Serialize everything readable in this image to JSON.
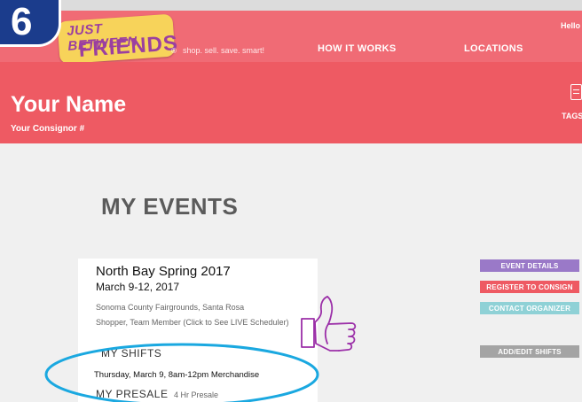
{
  "step_badge": "6",
  "logo": {
    "line1": "JUST BETWEEN",
    "line2": "FRIENDS",
    "reg": "®",
    "tagline": "shop. sell. save. smart!"
  },
  "nav": {
    "how_it_works": "HOW IT WORKS",
    "locations": "LOCATIONS",
    "hello": "Hello"
  },
  "header": {
    "name": "Your Name",
    "consignor": "Your Consignor #",
    "tags_label": "TAGS"
  },
  "page_title": "MY EVENTS",
  "event": {
    "name": "North Bay Spring 2017",
    "dates": "March 9-12, 2017",
    "venue": "Sonoma County Fairgrounds, Santa Rosa",
    "role": "Shopper, Team Member (Click to See LIVE Scheduler)",
    "shifts_heading": "MY SHIFTS",
    "shift": "Thursday, March 9, 8am-12pm Merchandise",
    "presale_heading": "MY PRESALE",
    "presale_detail": "4 Hr Presale"
  },
  "buttons": {
    "event_details": "EVENT DETAILS",
    "register": "REGISTER TO CONSIGN",
    "contact": "CONTACT ORGANIZER",
    "add_edit": "ADD/EDIT SHIFTS"
  },
  "colors": {
    "event_details": "#9a79c8",
    "register": "#ee5a63",
    "contact": "#8fd1d6",
    "add_edit": "#a4a4a4",
    "highlight": "#1aa8e0",
    "thumb": "#9b2fa8"
  },
  "icons": {
    "tags": "tag-list-icon",
    "annotation": "thumbs-up-icon"
  }
}
